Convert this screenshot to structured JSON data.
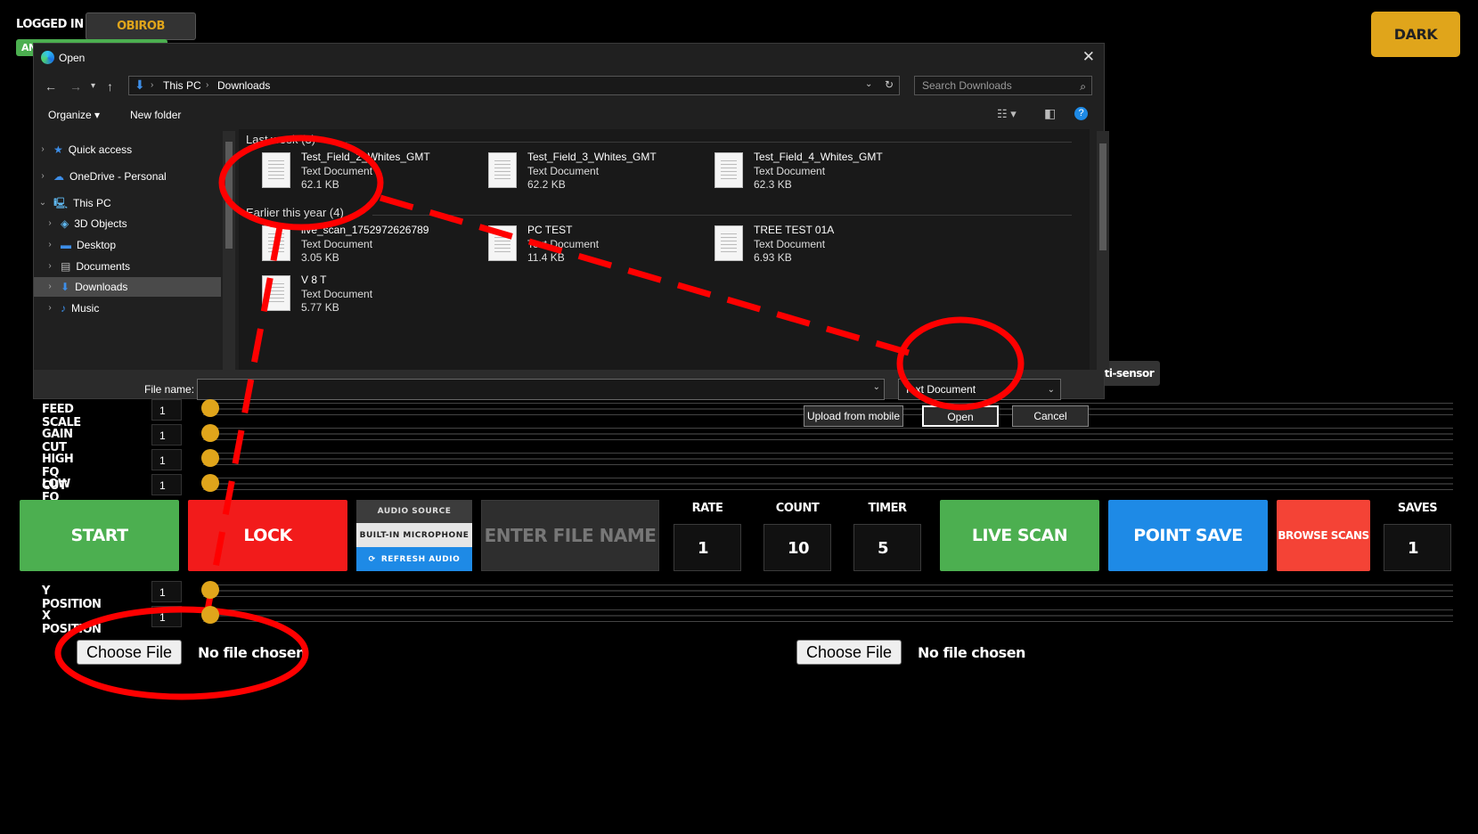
{
  "header": {
    "logged_in_label": "LOGGED IN AS:",
    "username": "OBIROB",
    "mode_chip": "AN",
    "theme_button": "DARK"
  },
  "sliders_top": [
    {
      "label": "FEED SCALE",
      "value": "1"
    },
    {
      "label": "GAIN CUT",
      "value": "1"
    },
    {
      "label": "HIGH FQ CUT",
      "value": "1"
    },
    {
      "label": "LOW FQ CUT",
      "value": "1"
    }
  ],
  "controls": {
    "start": "START",
    "lock": "LOCK",
    "audio_source": "AUDIO SOURCE",
    "audio_device": "BUILT-IN MICROPHONE",
    "refresh_audio": "REFRESH AUDIO",
    "filename_placeholder": "ENTER FILE NAME",
    "rate_label": "RATE",
    "rate_value": "1",
    "count_label": "COUNT",
    "count_value": "10",
    "timer_label": "TIMER",
    "timer_value": "5",
    "live_scan": "LIVE SCAN",
    "point_save": "POINT SAVE",
    "browse_scans": "BROWSE SCANS",
    "saves_label": "SAVES",
    "saves_value": "1"
  },
  "sliders_bottom": [
    {
      "label": "Y POSITION",
      "value": "1"
    },
    {
      "label": "X POSITION",
      "value": "1"
    }
  ],
  "file_inputs": [
    {
      "button": "Choose File",
      "status": "No file chosen"
    },
    {
      "button": "Choose File",
      "status": "No file chosen"
    }
  ],
  "tooltip": "ulti-sensor",
  "dialog": {
    "title": "Open",
    "breadcrumb": [
      "This PC",
      "Downloads"
    ],
    "search_placeholder": "Search Downloads",
    "organize": "Organize",
    "new_folder": "New folder",
    "nav": {
      "quick_access": "Quick access",
      "onedrive": "OneDrive - Personal",
      "this_pc": "This PC",
      "objects3d": "3D Objects",
      "desktop": "Desktop",
      "documents": "Documents",
      "downloads": "Downloads",
      "music": "Music"
    },
    "group1": "Last week (3)",
    "group2": "Earlier this year (4)",
    "files": [
      {
        "name": "Test_Field_2_Whites_GMT",
        "type": "Text Document",
        "size": "62.1 KB"
      },
      {
        "name": "Test_Field_3_Whites_GMT",
        "type": "Text Document",
        "size": "62.2 KB"
      },
      {
        "name": "Test_Field_4_Whites_GMT",
        "type": "Text Document",
        "size": "62.3 KB"
      },
      {
        "name": "live_scan_1752972626789",
        "type": "Text Document",
        "size": "3.05 KB"
      },
      {
        "name": "PC TEST",
        "type": "Text Document",
        "size": "11.4 KB"
      },
      {
        "name": "TREE TEST 01A",
        "type": "Text Document",
        "size": "6.93 KB"
      },
      {
        "name": "V 8 T",
        "type": "Text Document",
        "size": "5.77 KB"
      }
    ],
    "filename_label": "File name:",
    "filetype": "Text Document",
    "upload_mobile": "Upload from mobile",
    "open": "Open",
    "cancel": "Cancel"
  },
  "colors": {
    "accent": "#e0a51b",
    "green": "#4caf50",
    "red": "#f21b1b",
    "blue": "#1e8ae6",
    "annotation": "#ff0000"
  }
}
